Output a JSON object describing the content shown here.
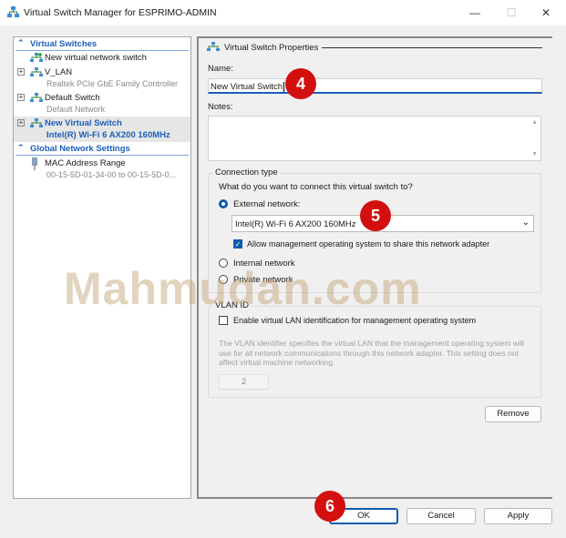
{
  "window": {
    "title": "Virtual Switch Manager for ESPRIMO-ADMIN",
    "minimize": "—",
    "maximize": "☐",
    "close": "✕"
  },
  "sidebar": {
    "virtual_switches": "Virtual Switches",
    "new_switch": "New virtual network switch",
    "switches": [
      {
        "name": "V_LAN",
        "adapter": "Realtek PCIe GbE Family Controller"
      },
      {
        "name": "Default Switch",
        "adapter": "Default Network"
      },
      {
        "name": "New Virtual Switch",
        "adapter": "Intel(R) Wi-Fi 6 AX200 160MHz"
      }
    ],
    "global": "Global Network Settings",
    "mac": {
      "label": "MAC Address Range",
      "value": "00-15-5D-01-34-00 to 00-15-5D-0..."
    }
  },
  "props": {
    "header": "Virtual Switch Properties",
    "name_label": "Name:",
    "name_value": "New Virtual Switch",
    "notes_label": "Notes:",
    "connection_type": "Connection type",
    "question": "What do you want to connect this virtual switch to?",
    "external": "External network:",
    "adapter": "Intel(R) Wi-Fi 6 AX200 160MHz",
    "allow_mgmt": "Allow management operating system to share this network adapter",
    "internal": "Internal network",
    "private": "Private network",
    "selected": "external",
    "vlan_id": "VLAN ID",
    "vlan_enable": "Enable virtual LAN identification for management operating system",
    "vlan_desc": "The VLAN identifier specifies the virtual LAN that the management operating system will use for all network communications through this network adapter. This setting does not affect virtual machine networking.",
    "vlan_value": "2",
    "remove": "Remove"
  },
  "footer": {
    "ok": "OK",
    "cancel": "Cancel",
    "apply": "Apply"
  },
  "annotations": {
    "step4": "4",
    "step5": "5",
    "step6": "6",
    "color": "#d40f0f"
  },
  "watermark": "Mahmudan.com"
}
